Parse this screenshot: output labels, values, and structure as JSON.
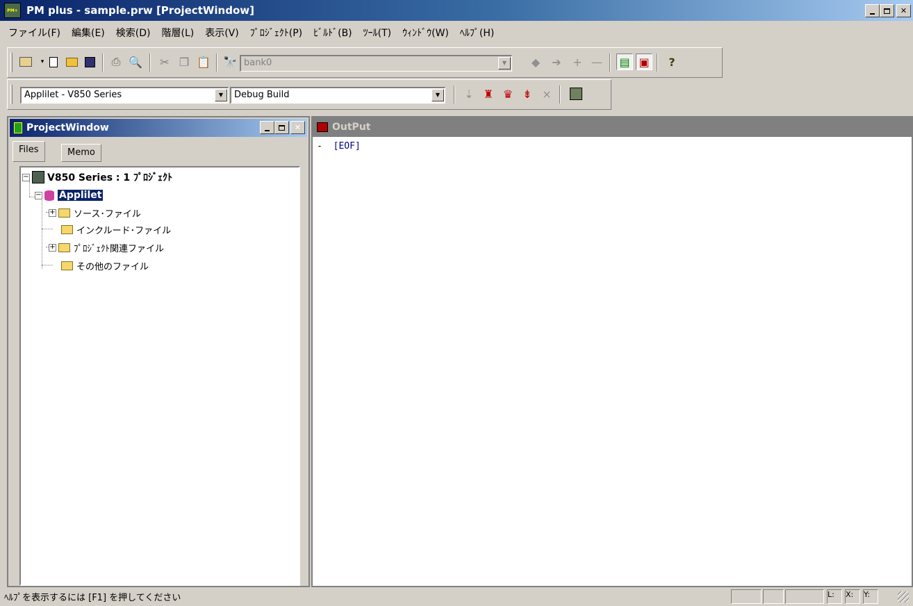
{
  "window": {
    "title": "PM plus - sample.prw [ProjectWindow]",
    "icon_text": "PM+"
  },
  "menu": [
    "ファイル(F)",
    "編集(E)",
    "検索(D)",
    "階層(L)",
    "表示(V)",
    "ﾌﾟﾛｼﾞｪｸﾄ(P)",
    "ﾋﾞﾙﾄﾞ(B)",
    "ﾂｰﾙ(T)",
    "ｳｨﾝﾄﾞｳ(W)",
    "ﾍﾙﾌﾟ(H)"
  ],
  "toolbar1": {
    "search_value": "bank0"
  },
  "toolbar2": {
    "project_combo": "Applilet - V850 Series",
    "build_combo": "Debug Build"
  },
  "project_window": {
    "title": "ProjectWindow",
    "tabs": [
      "Files",
      "Memo"
    ],
    "tree": {
      "root": "V850 Series : 1 ﾌﾟﾛｼﾞｪｸﾄ",
      "project": "Applilet",
      "folders": [
        "ソース･ファイル",
        "インクルード･ファイル",
        "ﾌﾟﾛｼﾞｪｸﾄ関連ファイル",
        "その他のファイル"
      ]
    }
  },
  "output_window": {
    "title": "OutPut",
    "lines": [
      "[EOF]"
    ]
  },
  "statusbar": {
    "help_text": "ﾍﾙﾌﾟを表示するには [F1] を押してください",
    "cells": [
      "L:",
      "X:",
      "Y:"
    ]
  },
  "colors": {
    "title_active": "#0a246a",
    "title_inactive": "#808080",
    "face": "#d4d0c8",
    "selection": "#0a246a",
    "output_text": "#000080"
  }
}
